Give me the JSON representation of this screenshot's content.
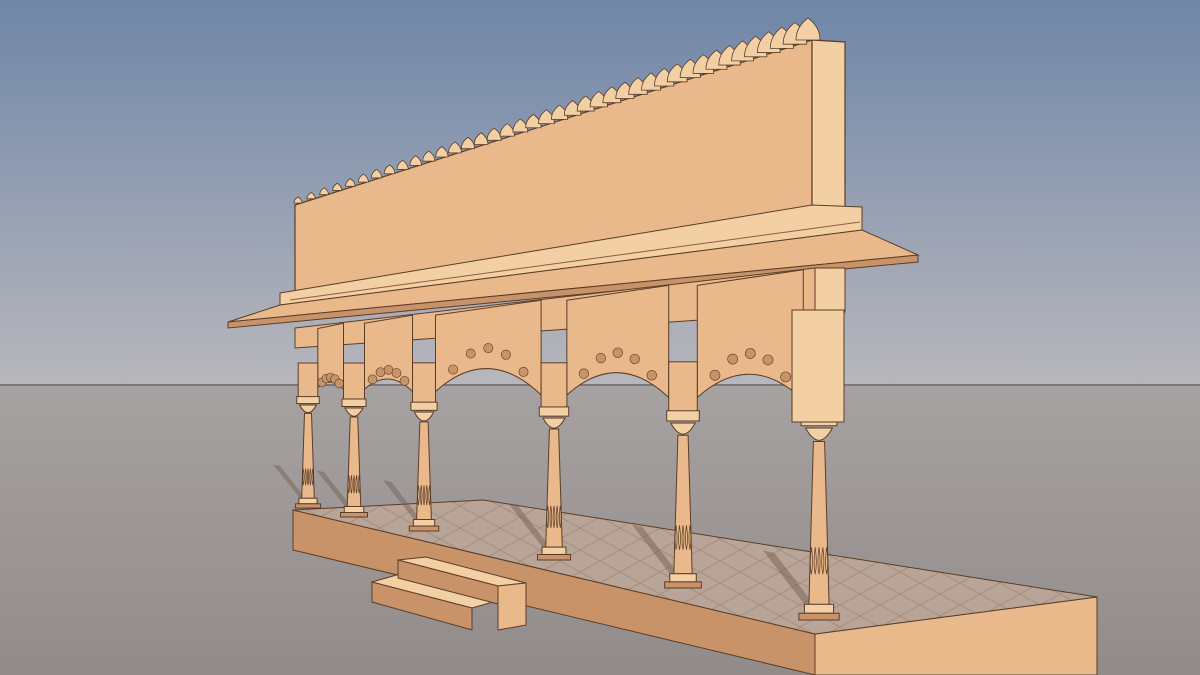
{
  "scene": {
    "subject": "pavilion-render",
    "column_count": 6,
    "step_count": 2,
    "colors": {
      "sky_top": "#6f86a8",
      "sky_horizon": "#b8b7bc",
      "ground": "#918b89",
      "ground_far": "#a7a2a2",
      "sandstone": "#e9b98b",
      "sandstone_light": "#f3cfa4",
      "sandstone_shade": "#c9936a",
      "outline": "#5a3d28",
      "floor": "#b9a597",
      "shadow": "#6e5a4e"
    }
  }
}
